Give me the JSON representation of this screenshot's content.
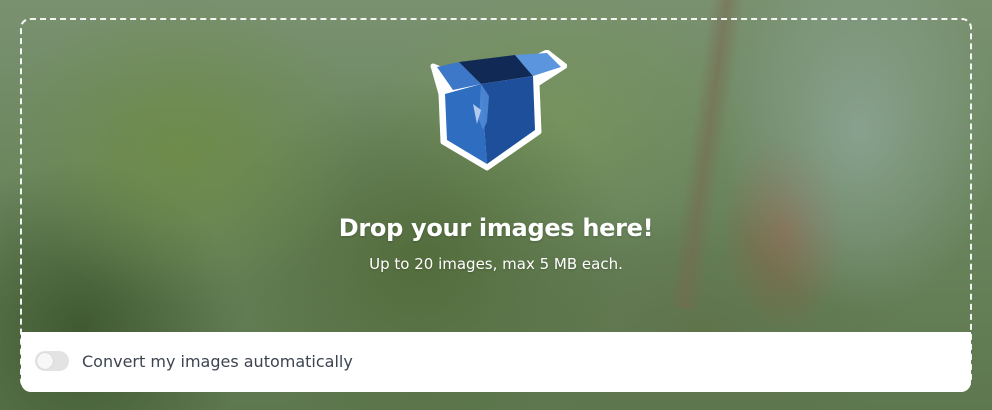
{
  "dropzone": {
    "title": "Drop your images here!",
    "subtitle": "Up to 20 images, max 5 MB each.",
    "icon": "open-box-icon"
  },
  "settings": {
    "auto_convert_label": "Convert my images automatically",
    "auto_convert_enabled": false
  },
  "colors": {
    "box_blue": "#2f6dc0",
    "box_dark": "#163a78",
    "toggle_off": "#e3e3e3",
    "label_text": "#3d4450"
  }
}
